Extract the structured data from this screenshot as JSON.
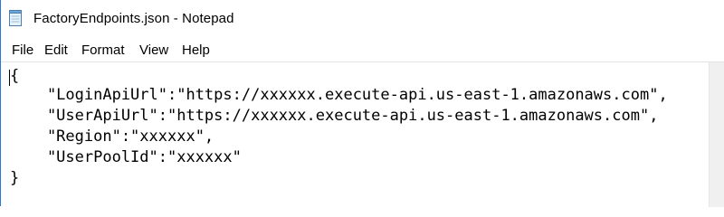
{
  "window": {
    "title": "FactoryEndpoints.json - Notepad"
  },
  "menu": {
    "items": [
      {
        "label": "File"
      },
      {
        "label": "Edit"
      },
      {
        "label": "Format"
      },
      {
        "label": "View"
      },
      {
        "label": "Help"
      }
    ]
  },
  "editor": {
    "lines": [
      "{",
      "    \"LoginApiUrl\":\"https://xxxxxx.execute-api.us-east-1.amazonaws.com\",",
      "    \"UserApiUrl\":\"https://xxxxxx.execute-api.us-east-1.amazonaws.com\",",
      "    \"Region\":\"xxxxxx\",",
      "    \"UserPoolId\":\"xxxxxx\"",
      "}"
    ]
  }
}
